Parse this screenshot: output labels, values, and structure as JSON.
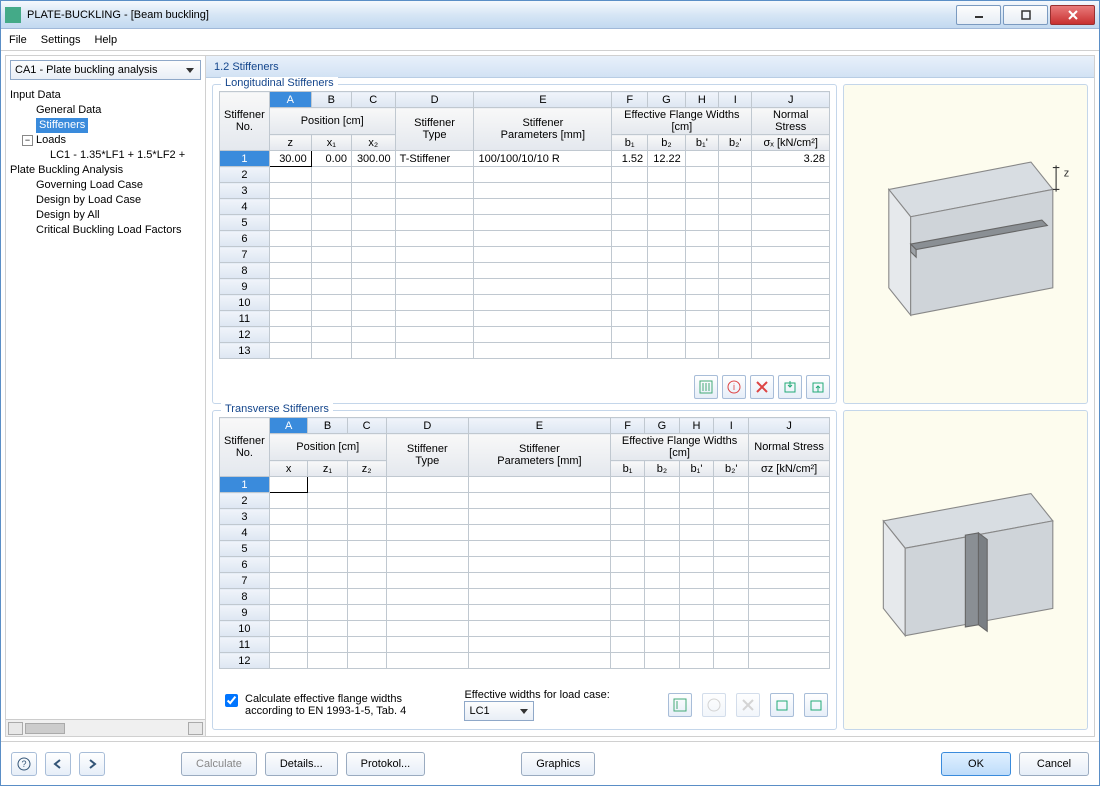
{
  "window": {
    "title": "PLATE-BUCKLING - [Beam buckling]"
  },
  "menu": {
    "file": "File",
    "settings": "Settings",
    "help": "Help"
  },
  "sidebar": {
    "combo": "CA1 - Plate buckling analysis",
    "input_data": "Input Data",
    "general_data": "General Data",
    "stiffeners": "Stiffeners",
    "loads": "Loads",
    "lc1": "LC1 - 1.35*LF1 + 1.5*LF2 +",
    "pba": "Plate Buckling Analysis",
    "gov": "Governing Load Case",
    "dblc": "Design by Load Case",
    "dba": "Design by All",
    "cblf": "Critical Buckling Load Factors"
  },
  "page": {
    "title": "1.2 Stiffeners"
  },
  "long": {
    "legend": "Longitudinal Stiffeners",
    "hdr_no": "Stiffener\nNo.",
    "hdr_pos": "Position [cm]",
    "hdr_type": "Stiffener\nType",
    "hdr_params": "Stiffener\nParameters [mm]",
    "hdr_efw": "Effective Flange Widths [cm]",
    "hdr_ns": "Normal Stress",
    "sub_z": "z",
    "sub_x1": "x₁",
    "sub_x2": "x₂",
    "sub_b1": "b₁",
    "sub_b2": "b₂",
    "sub_b1p": "b₁'",
    "sub_b2p": "b₂'",
    "sub_sx": "σₓ [kN/cm²]",
    "letters": [
      "A",
      "B",
      "C",
      "D",
      "E",
      "F",
      "G",
      "H",
      "I",
      "J"
    ],
    "rows_total": 13,
    "data": {
      "row": 1,
      "z": "30.00",
      "x1": "0.00",
      "x2": "300.00",
      "type": "T-Stiffener",
      "params": "100/100/10/10 R",
      "b1": "1.52",
      "b2": "12.22",
      "b1p": "",
      "b2p": "",
      "sx": "3.28"
    }
  },
  "trans": {
    "legend": "Transverse Stiffeners",
    "hdr_no": "Stiffener\nNo.",
    "hdr_pos": "Position [cm]",
    "hdr_type": "Stiffener\nType",
    "hdr_params": "Stiffener\nParameters [mm]",
    "hdr_efw": "Effective Flange Widths [cm]",
    "hdr_ns": "Normal Stress",
    "sub_x": "x",
    "sub_z1": "z₁",
    "sub_z2": "z₂",
    "sub_b1": "b₁",
    "sub_b2": "b₂",
    "sub_b1p": "b₁'",
    "sub_b2p": "b₂'",
    "sub_sz": "σz [kN/cm²]",
    "letters": [
      "A",
      "B",
      "C",
      "D",
      "E",
      "F",
      "G",
      "H",
      "I",
      "J"
    ],
    "rows_total": 12
  },
  "bottom": {
    "check_label": "Calculate effective flange widths\naccording to EN 1993-1-5, Tab. 4",
    "checked": true,
    "efw_label": "Effective widths for load case:",
    "efw_combo": "LC1"
  },
  "dim_label": "z",
  "footer": {
    "calculate": "Calculate",
    "details": "Details...",
    "protokol": "Protokol...",
    "graphics": "Graphics",
    "ok": "OK",
    "cancel": "Cancel"
  }
}
